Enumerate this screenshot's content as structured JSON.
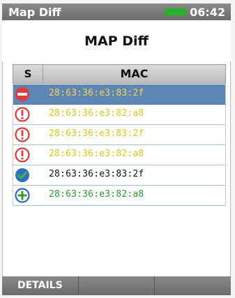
{
  "statusbar": {
    "title": "Map Diff",
    "time": "06:42",
    "battery_color": "#2bb02b"
  },
  "page": {
    "title": "MAP Diff"
  },
  "table": {
    "columns": {
      "status": "S",
      "mac": "MAC"
    },
    "rows": [
      {
        "status": "removed",
        "icon": "minus-icon",
        "mac": "28:63:36:e3:83:2f",
        "color": "#ffd34d",
        "selected": true
      },
      {
        "status": "changed",
        "icon": "exclamation-icon",
        "mac": "28:63:36:e3:82:a8",
        "color": "#e0c51a",
        "selected": false
      },
      {
        "status": "changed",
        "icon": "exclamation-icon",
        "mac": "28:63:36:e3:83:2f",
        "color": "#e0c51a",
        "selected": false
      },
      {
        "status": "changed",
        "icon": "exclamation-icon",
        "mac": "28:63:36:e3:82:a8",
        "color": "#e0c51a",
        "selected": false
      },
      {
        "status": "unchanged",
        "icon": "check-icon",
        "mac": "28:63:36:e3:83:2f",
        "color": "#111111",
        "selected": false
      },
      {
        "status": "added",
        "icon": "plus-icon",
        "mac": "28:63:36:e3:82:a8",
        "color": "#2a9a2a",
        "selected": false
      }
    ]
  },
  "softkeys": [
    "DETAILS",
    "",
    ""
  ]
}
